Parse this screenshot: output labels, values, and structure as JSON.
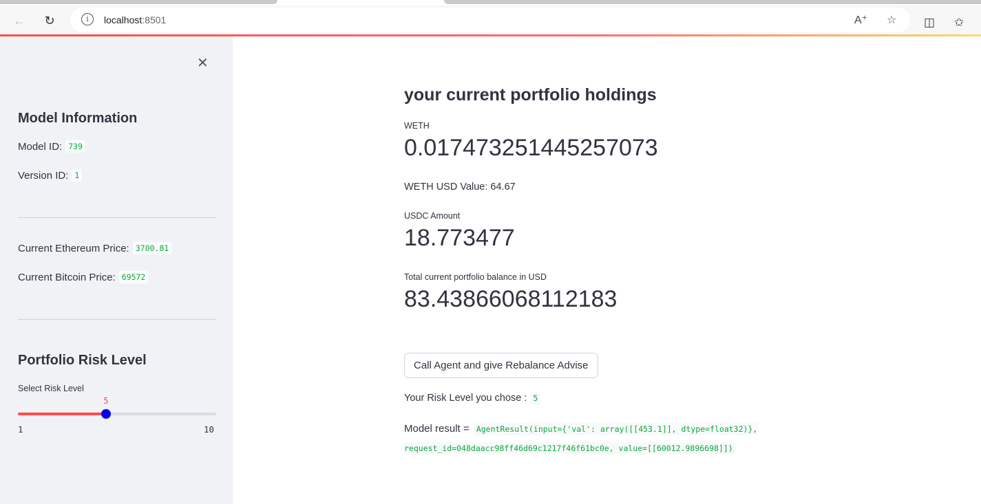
{
  "browser": {
    "url_host": "localhost",
    "url_port": ":8501"
  },
  "sidebar": {
    "model_info_title": "Model Information",
    "model_id_label": "Model ID:",
    "model_id_value": "739",
    "version_id_label": "Version ID:",
    "version_id_value": "1",
    "eth_price_label": "Current Ethereum Price:",
    "eth_price_value": "3700.81",
    "btc_price_label": "Current Bitcoin Price:",
    "btc_price_value": "69572",
    "risk_title": "Portfolio Risk Level",
    "slider_label": "Select Risk Level",
    "slider_value": "5",
    "slider_min": "1",
    "slider_max": "10",
    "slider_value_num": 5,
    "slider_min_num": 1,
    "slider_max_num": 10
  },
  "main": {
    "title": "your current portfolio holdings",
    "weth_label": "WETH",
    "weth_value": "0.017473251445257073",
    "weth_usd_text": "WETH USD Value: 64.67",
    "usdc_label": "USDC Amount",
    "usdc_value": "18.773477",
    "total_label": "Total current portfolio balance in USD",
    "total_value": "83.43866068112183",
    "agent_button": "Call Agent and give Rebalance Advise",
    "risk_chosen_label": "Your Risk Level you chose :",
    "risk_chosen_value": "5",
    "result_label": "Model result =",
    "result_value": "AgentResult(input={'val': array([[453.1]], dtype=float32)}, request_id=048daacc98ff46d69c1217f46f61bc0e, value=[[60012.9896698]])"
  },
  "colors": {
    "accent": "#ff4b4b",
    "code_text": "#09ab3b",
    "slider_thumb": "#0000ee",
    "sidebar_bg": "#f0f2f6"
  }
}
